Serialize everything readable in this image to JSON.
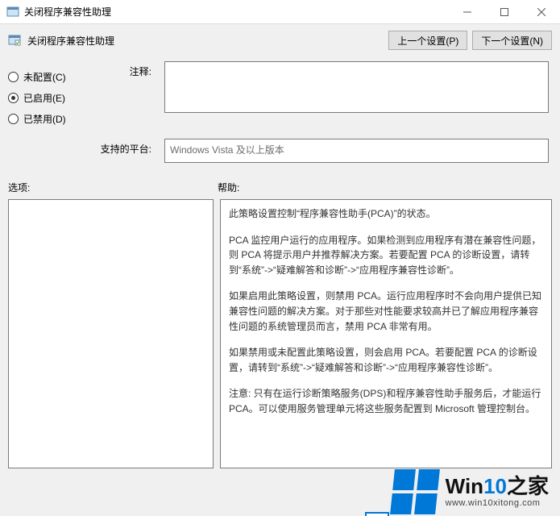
{
  "window": {
    "title": "关闭程序兼容性助理",
    "minimize_tip": "最小化",
    "maximize_tip": "最大化",
    "close_tip": "关闭"
  },
  "header": {
    "policy_title": "关闭程序兼容性助理",
    "prev_button": "上一个设置(P)",
    "next_button": "下一个设置(N)"
  },
  "radios": {
    "not_configured": "未配置(C)",
    "enabled": "已启用(E)",
    "disabled": "已禁用(D)",
    "selected": "enabled"
  },
  "labels": {
    "comment": "注释:",
    "supported": "支持的平台:",
    "options": "选项:",
    "help": "帮助:"
  },
  "fields": {
    "comment_value": "",
    "supported_value": "Windows Vista 及以上版本"
  },
  "help": {
    "p1": "此策略设置控制“程序兼容性助手(PCA)”的状态。",
    "p2": "PCA 监控用户运行的应用程序。如果检测到应用程序有潜在兼容性问题，则 PCA 将提示用户并推荐解决方案。若要配置 PCA 的诊断设置，请转到“系统”->“疑难解答和诊断”->“应用程序兼容性诊断”。",
    "p3": "如果启用此策略设置，则禁用 PCA。运行应用程序时不会向用户提供已知兼容性问题的解决方案。对于那些对性能要求较高并已了解应用程序兼容性问题的系统管理员而言，禁用 PCA 非常有用。",
    "p4": "如果禁用或未配置此策略设置，则会启用 PCA。若要配置 PCA 的诊断设置，请转到“系统”->“疑难解答和诊断”->“应用程序兼容性诊断”。",
    "p5": "注意: 只有在运行诊断策略服务(DPS)和程序兼容性助手服务后，才能运行 PCA。可以使用服务管理单元将这些服务配置到 Microsoft 管理控制台。"
  },
  "watermark": {
    "brand_a": "Win",
    "brand_b": "10",
    "brand_c": "之家",
    "url": "www.win10xitong.com"
  }
}
